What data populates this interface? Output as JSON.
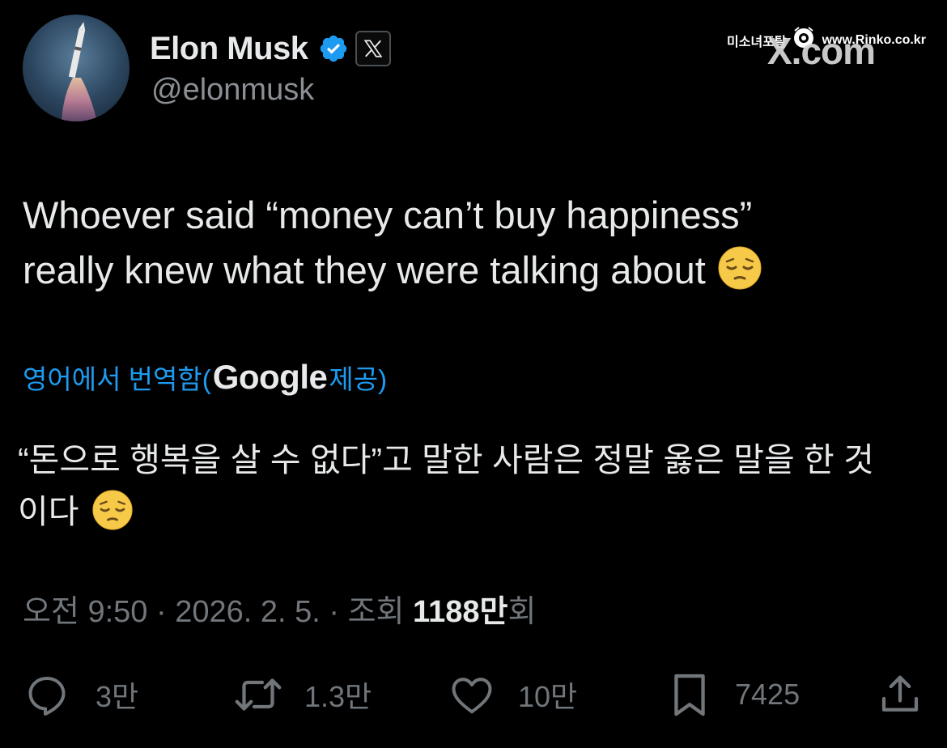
{
  "author": {
    "name": "Elon Musk",
    "handle": "@elonmusk",
    "verified_color": "#1d9bf0"
  },
  "watermark": {
    "korean_text": "미소녀포탈",
    "site": "www.Rinko.co.kr",
    "brand": "X.com"
  },
  "tweet": {
    "text_line1": "Whoever said “money can’t buy happiness”",
    "text_line2": "really knew what they were talking about",
    "emoji_name": "pensive-face",
    "translate_prefix": "영어에서 번역함(",
    "translate_brand": "Google",
    "translate_suffix": " 제공)",
    "translated_line1": "“돈으로 행복을 살 수 없다”고 말한 사람은 정말 옳은 말을 한 것",
    "translated_line2": "이다"
  },
  "meta": {
    "datetime": "오전 9:50 · 2026. 2. 5. · 조회 ",
    "views_count": "1188만",
    "views_suffix": "회"
  },
  "actions": {
    "replies": "3만",
    "reposts": "1.3만",
    "likes": "10만",
    "bookmarks": "7425"
  },
  "colors": {
    "background": "#000000",
    "text": "#e7e9ea",
    "muted": "#71767b",
    "accent": "#1d9bf0"
  }
}
